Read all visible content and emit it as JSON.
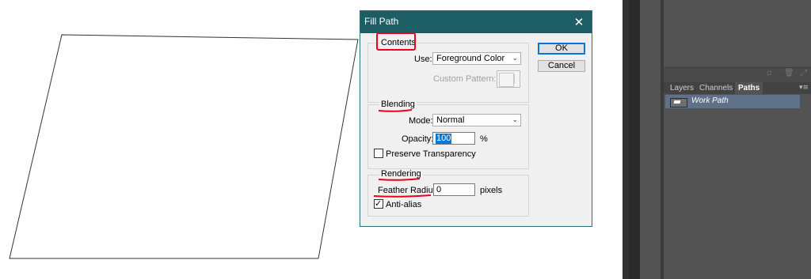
{
  "dialog": {
    "title": "Fill Path",
    "ok_label": "OK",
    "cancel_label": "Cancel",
    "contents": {
      "group_label": "Contents",
      "use_label": "Use:",
      "use_value": "Foreground Color",
      "custom_pattern_label": "Custom Pattern:"
    },
    "blending": {
      "group_label": "Blending",
      "mode_label": "Mode:",
      "mode_value": "Normal",
      "opacity_label": "Opacity:",
      "opacity_value": "100",
      "opacity_unit": "%",
      "preserve_transparency_label": "Preserve Transparency",
      "preserve_transparency_checked": false
    },
    "rendering": {
      "group_label": "Rendering",
      "feather_radius_label": "Feather Radius:",
      "feather_radius_value": "0",
      "feather_radius_unit": "pixels",
      "anti_alias_label": "Anti-alias",
      "anti_alias_checked": true
    }
  },
  "paths_panel": {
    "tabs": [
      {
        "label": "Layers",
        "active": false
      },
      {
        "label": "Channels",
        "active": false
      },
      {
        "label": "Paths",
        "active": true
      }
    ],
    "items": [
      {
        "label": "Work Path",
        "selected": true
      }
    ]
  },
  "colors": {
    "titlebar": "#1d5e66",
    "annotation": "#e8001c",
    "selected_row": "#5f7189",
    "panel_bg": "#535353"
  },
  "icons": [
    "close-icon",
    "chevron-down-icon",
    "checkmark-icon",
    "trash-icon",
    "new-path-icon",
    "panel-menu-icon",
    "path-thumbnail-icon"
  ]
}
